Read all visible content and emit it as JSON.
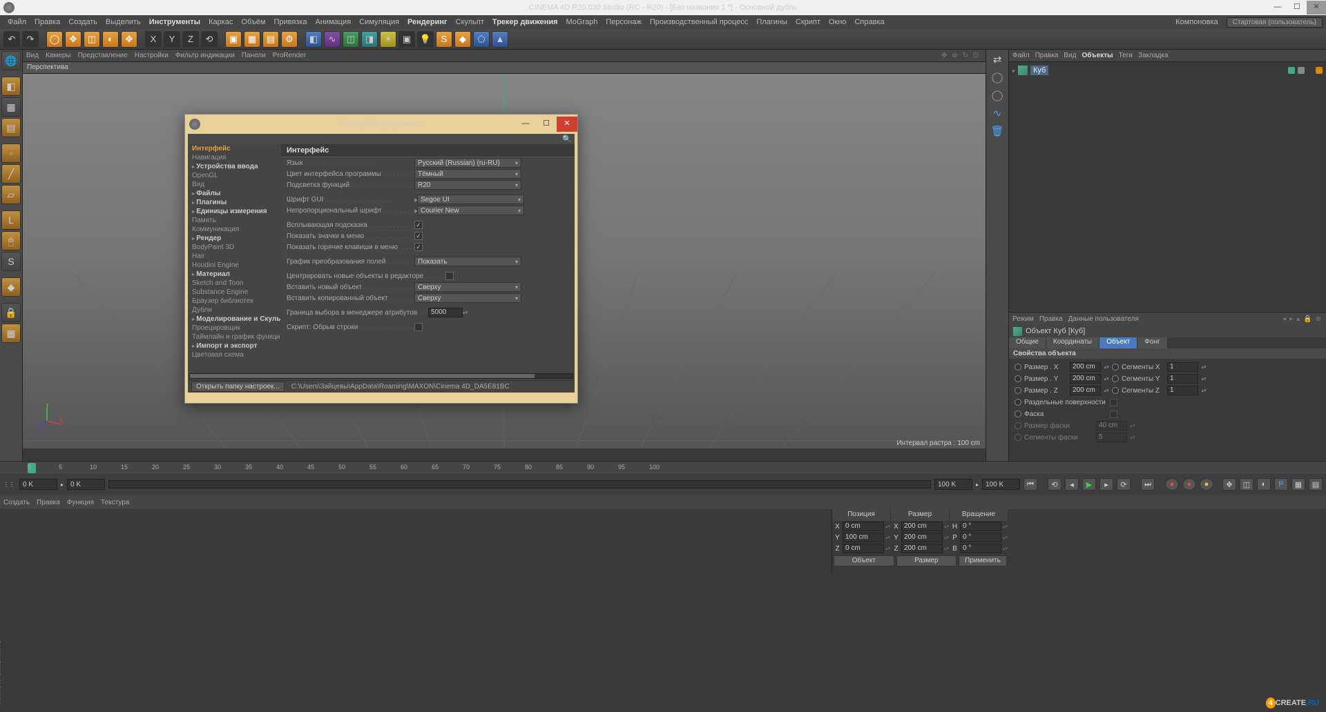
{
  "window": {
    "title": "CINEMA 4D R20.030 Studio (RC - R20) - [Без названия 1 *] - Основной дубль"
  },
  "mainMenu": [
    "Файл",
    "Правка",
    "Создать",
    "Выделить",
    "Инструменты",
    "Каркас",
    "Объём",
    "Привязка",
    "Анимация",
    "Симуляция",
    "Рендеринг",
    "Скульпт",
    "Трекер движения",
    "MoGraph",
    "Персонаж",
    "Производственный процесс",
    "Плагины",
    "Скрипт",
    "Окно",
    "Справка"
  ],
  "mainMenuBold": [
    "Инструменты",
    "Рендеринг",
    "Трекер движения"
  ],
  "layout": {
    "label": "Компоновка",
    "preset": "Стартовая (пользователь)"
  },
  "viewMenu": [
    "Вид",
    "Камеры",
    "Представление",
    "Настройки",
    "Фильтр индикации",
    "Панели",
    "ProRender"
  ],
  "viewTitle": "Перспектива",
  "viewInfo": "Интервал растра : 100 cm",
  "objMgrMenu": [
    "Файл",
    "Правка",
    "Вид",
    "Объекты",
    "Теги",
    "Закладка"
  ],
  "objMgrMenuBold": "Объекты",
  "objTree": {
    "item": "Куб"
  },
  "attrMenu": [
    "Режим",
    "Правка",
    "Данные пользователя"
  ],
  "attrHead": "Объект Куб [Куб]",
  "attrTabs": [
    "Общие",
    "Координаты",
    "Объект",
    "Фонг"
  ],
  "attrTabActive": "Объект",
  "attrSection": "Свойства объекта",
  "attrRows": {
    "sizeX": {
      "label": "Размер . X",
      "val": "200 cm"
    },
    "sizeY": {
      "label": "Размер . Y",
      "val": "200 cm"
    },
    "sizeZ": {
      "label": "Размер . Z",
      "val": "200 cm"
    },
    "segX": {
      "label": "Сегменты X",
      "val": "1"
    },
    "segY": {
      "label": "Сегменты Y",
      "val": "1"
    },
    "segZ": {
      "label": "Сегменты Z",
      "val": "1"
    },
    "sepSurf": "Раздельные поверхности",
    "fillet": "Фаска",
    "filletR": {
      "label": "Размер фаски",
      "val": "40 cm"
    },
    "filletS": {
      "label": "Сегменты фаски",
      "val": "5"
    }
  },
  "timeline": {
    "frameStart": "0 K",
    "frameEnd": "100 K",
    "ticks": [
      "0",
      "5",
      "10",
      "15",
      "20",
      "25",
      "30",
      "35",
      "40",
      "45",
      "50",
      "55",
      "60",
      "65",
      "70",
      "75",
      "80",
      "85",
      "90",
      "95",
      "100"
    ]
  },
  "matMenu": [
    "Создать",
    "Правка",
    "Функция",
    "Текстура"
  ],
  "coord": {
    "headers": [
      "Позиция",
      "Размер",
      "Вращение"
    ],
    "x": {
      "pos": "0 cm",
      "size": "200 cm",
      "rot": "0 °",
      "hl": "H"
    },
    "y": {
      "pos": "100 cm",
      "size": "200 cm",
      "rot": "0 °",
      "hl": "P"
    },
    "z": {
      "pos": "0 cm",
      "size": "200 cm",
      "rot": "0 °",
      "hl": "B"
    },
    "selObj": "Объект",
    "selSize": "Размер",
    "apply": "Применить"
  },
  "dialog": {
    "title": "Настройки программы",
    "tree": [
      "Интерфейс",
      "Навигация",
      "Устройства ввода",
      "OpenGL",
      "Вид",
      "Файлы",
      "Плагины",
      "Единицы измерения",
      "Память",
      "Коммуникация",
      "Рендер",
      "BodyPaint 3D",
      "Hair",
      "Houdini Engine",
      "Материал",
      "Sketch and Toon",
      "Substance Engine",
      "Браузер библиотек",
      "Дубли",
      "Моделирование и Скульпт",
      "Проецировщик",
      "Таймлайн и график функци",
      "Импорт и экспорт",
      "Цветовая схема"
    ],
    "treeBold": [
      "Устройства ввода",
      "Файлы",
      "Плагины",
      "Единицы измерения",
      "Рендер",
      "Материал",
      "Моделирование и Скульпт",
      "Импорт и экспорт"
    ],
    "treeSelected": "Интерфейс",
    "section": "Интерфейс",
    "rows": {
      "lang": {
        "label": "Язык",
        "val": "Русский (Russian) (ru-RU)"
      },
      "scheme": {
        "label": "Цвет интерфейса программы",
        "val": "Тёмный"
      },
      "highlight": {
        "label": "Подсветка функций",
        "val": "R20"
      },
      "guiFont": {
        "label": "Шрифт GUI",
        "val": "Segoe UI"
      },
      "monoFont": {
        "label": "Непропорциональный шрифт",
        "val": "Courier New"
      },
      "tooltip": {
        "label": "Всплывающая подсказка",
        "checked": true
      },
      "menuIcons": {
        "label": "Показать значки в меню",
        "checked": true
      },
      "menuHotkeys": {
        "label": "Показать горячие клавиши в меню",
        "checked": true
      },
      "fieldGraph": {
        "label": "График преобразования полей",
        "val": "Показать"
      },
      "centerNew": {
        "label": "Центрировать новые объекты в редакторе",
        "checked": false
      },
      "insertNew": {
        "label": "Вставить новый объект",
        "val": "Сверху"
      },
      "insertCopy": {
        "label": "Вставить копированный объект",
        "val": "Сверху"
      },
      "attrLimit": {
        "label": "Граница выбора в менеджере атрибутов",
        "val": "5000"
      },
      "scriptWrap": {
        "label": "Скрипт: Обрыв строки",
        "checked": false
      }
    },
    "footBtn": "Открыть папку настроек...",
    "footPath": "C:\\Users\\Зайцевы\\AppData\\Roaming\\MAXON\\Cinema 4D_DA5E81BC"
  },
  "watermark": {
    "four": "4",
    "create": "CREATE",
    "ru": ".RU"
  }
}
